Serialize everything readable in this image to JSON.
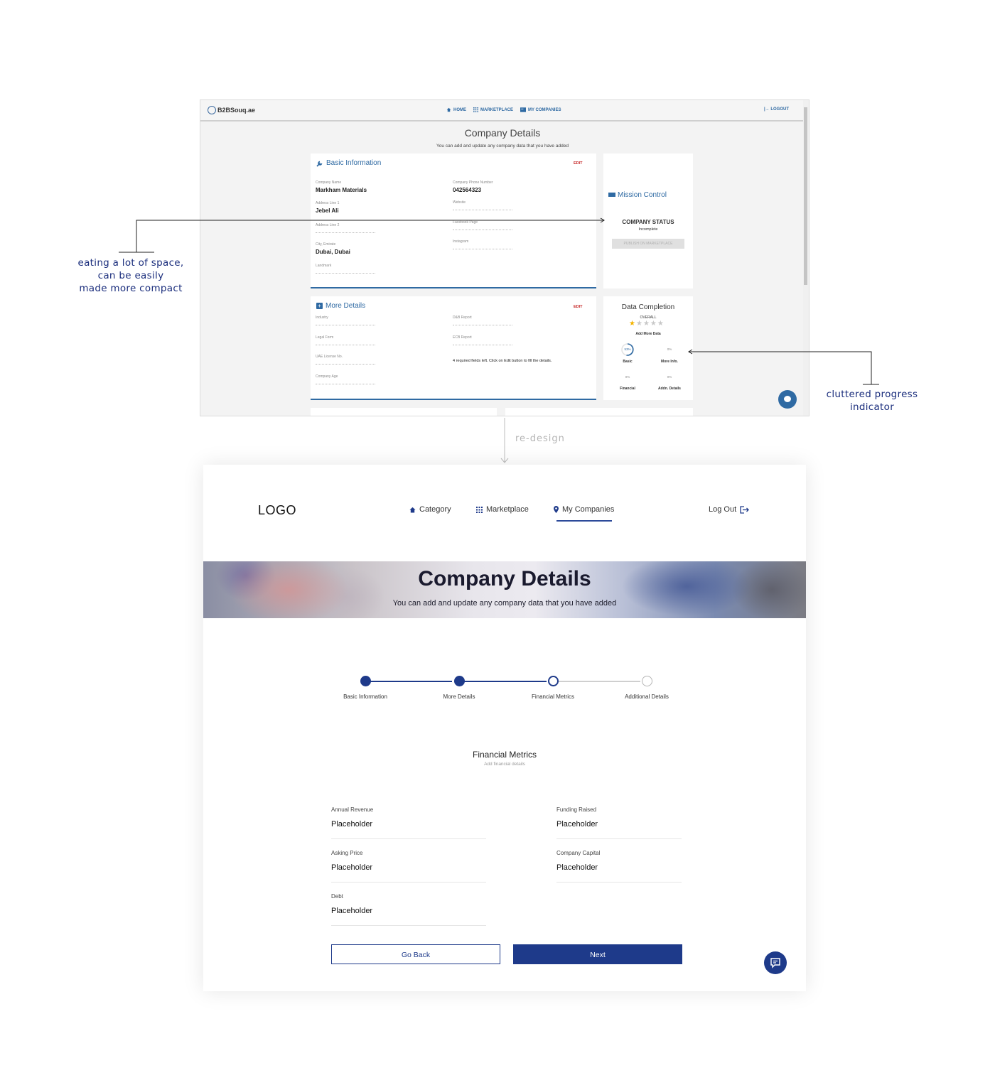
{
  "old_ui": {
    "brand": "B2BSouq.ae",
    "nav": [
      "HOME",
      "MARKETPLACE",
      "MY COMPANIES"
    ],
    "logout": "LOGOUT",
    "title": "Company Details",
    "subtitle": "You can add and update any company data that you have added",
    "basic_info": {
      "title": "Basic Information",
      "edit": "EDIT",
      "fields": [
        {
          "label": "Company Name",
          "value": "Markham Materials"
        },
        {
          "label": "Company Phone Number",
          "value": "042564323"
        },
        {
          "label": "Address Line 1",
          "value": "Jebel Ali"
        },
        {
          "label": "Website",
          "value": ""
        },
        {
          "label": "Address Line 2",
          "value": ""
        },
        {
          "label": "Facebook Page",
          "value": ""
        },
        {
          "label": "City, Emirate",
          "value": "Dubai, Dubai"
        },
        {
          "label": "Instagram",
          "value": ""
        },
        {
          "label": "Landmark",
          "value": ""
        }
      ]
    },
    "mission_control": {
      "title": "Mission Control",
      "status_label": "COMPANY STATUS",
      "status_value": "Incomplete",
      "publish": "PUBLISH ON MARKETPLACE"
    },
    "more_details": {
      "title": "More Details",
      "edit": "EDIT",
      "fields": [
        "Industry",
        "D&B Report",
        "Legal Form",
        "ECB Report",
        "UAE License No.",
        "Company Age"
      ],
      "note": "4 required fields left. Click on Edit button to fill the details."
    },
    "data_completion": {
      "title": "Data Completion",
      "overall": "OVERALL",
      "stars_filled": 1,
      "stars_total": 5,
      "add_more": "Add More Data",
      "items": [
        {
          "label": "Basic",
          "percent": "53%"
        },
        {
          "label": "More Info.",
          "percent": "0%"
        },
        {
          "label": "Financial",
          "percent": "0%"
        },
        {
          "label": "Addn. Details",
          "percent": "0%"
        }
      ]
    }
  },
  "annotations": {
    "left": [
      "eating a lot of space,",
      "can be easily",
      "made more compact"
    ],
    "right": [
      "cluttered progress",
      "indicator"
    ],
    "redesign": "re-design"
  },
  "new_ui": {
    "logo": "LOGO",
    "nav": [
      {
        "label": "Category",
        "icon": "home-icon"
      },
      {
        "label": "Marketplace",
        "icon": "grid-icon"
      },
      {
        "label": "My Companies",
        "icon": "location-pin-icon",
        "active": true
      }
    ],
    "logout": "Log Out",
    "hero_title": "Company Details",
    "hero_subtitle": "You can add and update any company data that you have added",
    "steps": [
      {
        "label": "Basic Information",
        "state": "done"
      },
      {
        "label": "More Details",
        "state": "done"
      },
      {
        "label": "Financial Metrics",
        "state": "current"
      },
      {
        "label": "Additional Details",
        "state": "todo"
      }
    ],
    "section_title": "Financial Metrics",
    "section_subtitle": "Add financial details",
    "fields": [
      {
        "label": "Annual Revenue",
        "value": "Placeholder"
      },
      {
        "label": "Funding Raised",
        "value": "Placeholder"
      },
      {
        "label": "Asking Price",
        "value": "Placeholder"
      },
      {
        "label": "Company Capital",
        "value": "Placeholder"
      },
      {
        "label": "Debt",
        "value": "Placeholder"
      }
    ],
    "back_button": "Go Back",
    "next_button": "Next"
  },
  "colors": {
    "old_accent": "#2f6aa3",
    "new_primary": "#1e3a8a",
    "annotation": "#1a2d7c"
  }
}
